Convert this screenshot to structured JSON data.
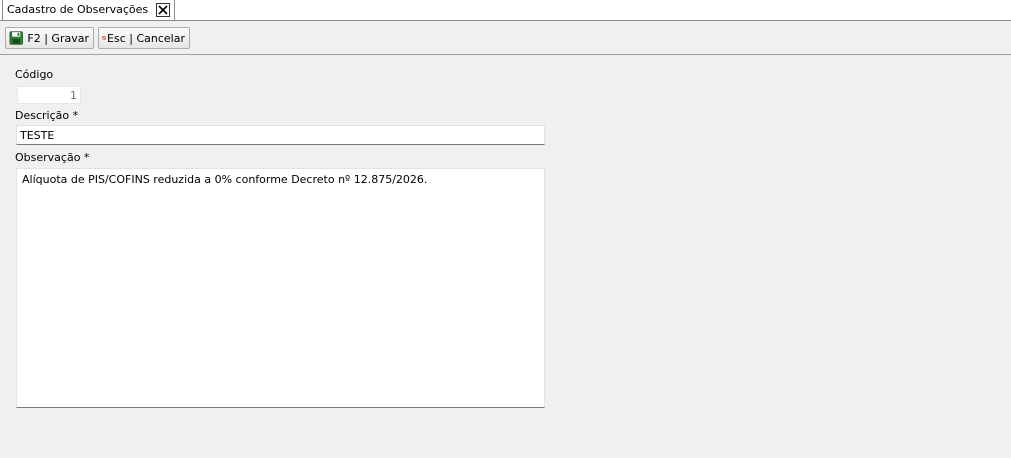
{
  "tab": {
    "title": "Cadastro de Observações",
    "close_icon": "close-icon"
  },
  "toolbar": {
    "save_label": "F2 | Gravar",
    "save_icon": "floppy-disk-icon",
    "cancel_label": "Esc | Cancelar",
    "cancel_icon": "no-entry-icon"
  },
  "form": {
    "codigo_label": "Código",
    "codigo_value": "1",
    "descricao_label": "Descrição *",
    "descricao_value": "TESTE",
    "observacao_label": "Observação *",
    "observacao_value": "Alíquota de PIS/COFINS reduzida a 0% conforme Decreto nº 12.875/2026."
  },
  "colors": {
    "background": "#f0f0f0",
    "field_background": "#ffffff",
    "save_icon_green": "#2e7d32",
    "cancel_icon_red": "#c62828"
  }
}
